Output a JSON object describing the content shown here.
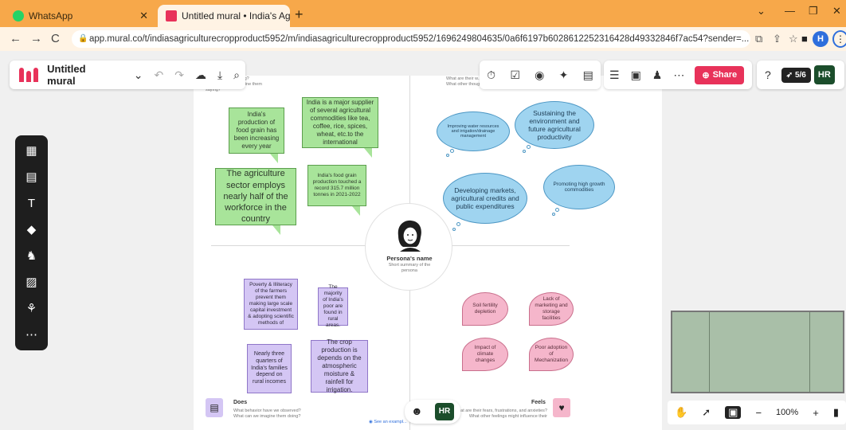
{
  "browser": {
    "tabs": [
      {
        "title": "WhatsApp",
        "favicon_color": "#25d366"
      },
      {
        "title": "Untitled mural • India's Agricultu",
        "favicon_color": "#e8325a"
      }
    ],
    "url": "app.mural.co/t/indiasagriculturecropproduct5952/m/indiasagriculturecropproduct5952/1696249804635/0a6f6197b6028612252316428d49332846f7ac54?sender=...",
    "profile_initial": "H"
  },
  "toolbar": {
    "mural_title": "Untitled mural",
    "share_label": "Share",
    "users_label": "5/6",
    "user_initials": "HR"
  },
  "quadrants": {
    "says": {
      "question": "What are they saying?\nWhat might we imagine them saying?"
    },
    "thinks": {
      "question": "What are their w...\nWhat other thoughts..."
    },
    "does": {
      "label": "Does",
      "question": "What behavior have we observed?\nWhat can we imagine them doing?"
    },
    "feels": {
      "label": "Feels",
      "question": "What are their fears, frustrations, and anxieties?\nWhat other feelings might influence their behavior?"
    }
  },
  "says_notes": [
    "India's production of food grain has been increasing every year",
    "India is a major supplier of several agricultural commodities like tea, coffee, rice, spices, wheat, etc.to the international",
    "The agriculture sector employs nearly half of the workforce in the country",
    "India's food grain production touched a record 315.7 million tonnes in 2021-2022"
  ],
  "thinks_notes": [
    "Improving water resources and irrigation/drainage management",
    "Sustaining the environment and future agricultural productivity",
    "Developing markets, agricultural credits and public expenditures",
    "Promoting high growth commodities"
  ],
  "does_notes": [
    "Poverty & Illiteracy of the farmers prevent them making large scale capital investment & adopting scientific methods of",
    "The majority of India's poor are found in rural areas.",
    "Nearly three quarters of India's families depend on rural incomes",
    "The crop production is depends on the atmospheric moisture & rainfell for irrigation."
  ],
  "feels_notes": [
    "Soil fertility depletion",
    "Lack of marketing and storage facilities",
    "Impact of climate changes",
    "Poor adoption of Mechanization"
  ],
  "persona": {
    "name": "Persona's name",
    "summary": "Short summary of the persona"
  },
  "bottom": {
    "see_example": "See an exampl...",
    "user_initials": "HR"
  },
  "zoom": {
    "level": "100%"
  },
  "colors": {
    "accent": "#e8325a",
    "sticky_green": "#a8e49a",
    "cloud_blue": "#9fd4f0",
    "note_violet": "#d4c6f4",
    "note_pink": "#f5b6cb"
  }
}
